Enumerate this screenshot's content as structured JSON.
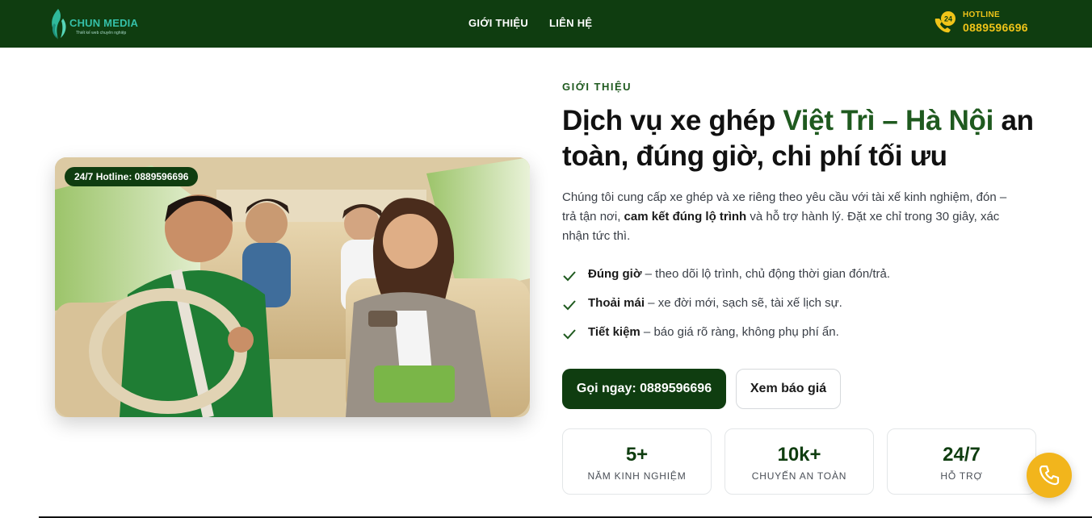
{
  "header": {
    "brand": "CHUN MEDIA",
    "brand_tagline": "Thiết kế web chuyên nghiệp",
    "nav": [
      "GIỚI THIỆU",
      "LIÊN HỆ"
    ],
    "hotline_badge": "24",
    "hotline_label": "HOTLINE",
    "hotline_number": "0889596696",
    "icons": [
      "logo-flame-icon",
      "phone-24-icon"
    ]
  },
  "hero": {
    "image_badge": "24/7 Hotline: 0889596696",
    "eyebrow": "GIỚI THIỆU",
    "title_before": "Dịch vụ xe ghép ",
    "title_accent": "Việt Trì – Hà Nội",
    "title_after": " an toàn, đúng giờ, chi phí tối ưu",
    "description_1": "Chúng tôi cung cấp xe ghép và xe riêng theo yêu cầu với tài xế kinh nghiệm, đón – trả tận nơi, ",
    "description_bold": "cam kết đúng lộ trình",
    "description_2": " và hỗ trợ hành lý. Đặt xe chỉ trong 30 giây, xác nhận tức thì.",
    "features": [
      {
        "title": "Đúng giờ",
        "text": " – theo dõi lộ trình, chủ động thời gian đón/trả."
      },
      {
        "title": "Thoải mái",
        "text": " – xe đời mới, sạch sẽ, tài xế lịch sự."
      },
      {
        "title": "Tiết kiệm",
        "text": " – báo giá rõ ràng, không phụ phí ẩn."
      }
    ],
    "primary_button": "Gọi ngay: 0889596696",
    "secondary_button": "Xem báo giá",
    "stats": [
      {
        "value": "5+",
        "label": "NĂM KINH NGHIỆM"
      },
      {
        "value": "10k+",
        "label": "CHUYẾN AN TOÀN"
      },
      {
        "value": "24/7",
        "label": "HỖ TRỢ"
      }
    ]
  },
  "colors": {
    "brand_green": "#0f3d10",
    "accent_green": "#1f5a1f",
    "gold": "#f0c419",
    "call_button": "#f2b51c"
  }
}
